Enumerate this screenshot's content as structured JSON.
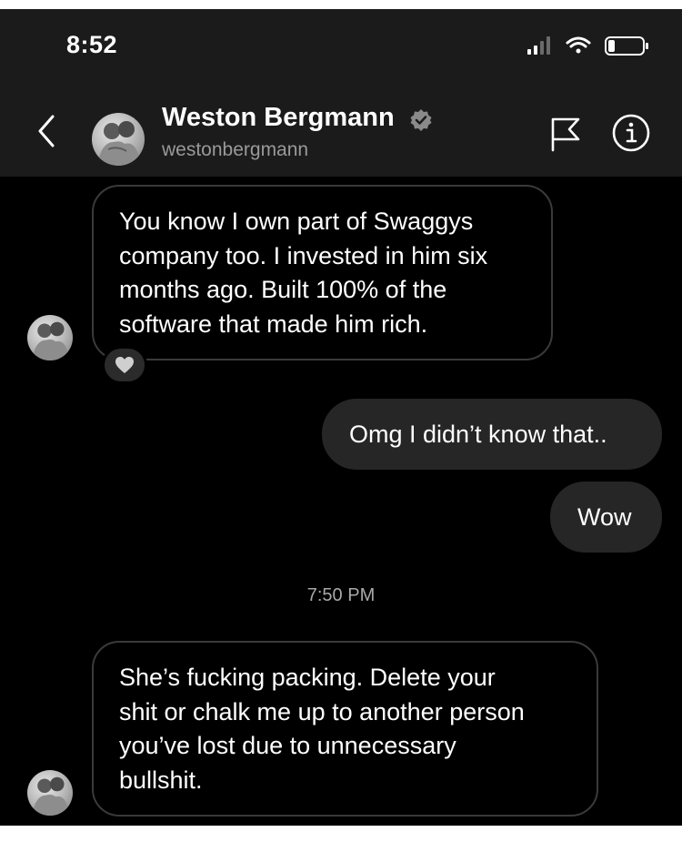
{
  "status_bar": {
    "time": "8:52",
    "icons": [
      "cellular-signal-icon",
      "wifi-icon",
      "battery-icon"
    ]
  },
  "header": {
    "name": "Weston Bergmann",
    "username": "westonbergmann",
    "verified": true,
    "actions": [
      "flag-icon",
      "info-icon"
    ]
  },
  "messages": [
    {
      "sender": "them",
      "text": "You know I own part of Swaggys\ncompany too. I invested in him six\nmonths ago. Built 100% of the\nsoftware that made him rich.",
      "reaction": "heart-icon"
    },
    {
      "sender": "me",
      "text": "Omg I didn’t know that.."
    },
    {
      "sender": "me",
      "text": "Wow"
    },
    {
      "sender": "them",
      "text": "She’s fucking packing. Delete your\nshit or chalk me up to another person\nyou’ve lost due to unnecessary\nbullshit."
    }
  ],
  "timestamp": "7:50 PM",
  "colors": {
    "background": "#000000",
    "header_bg": "#1b1b1b",
    "outgoing_bubble": "#262626",
    "incoming_border": "#3a3a3a",
    "secondary_text": "#9a9a9a"
  }
}
